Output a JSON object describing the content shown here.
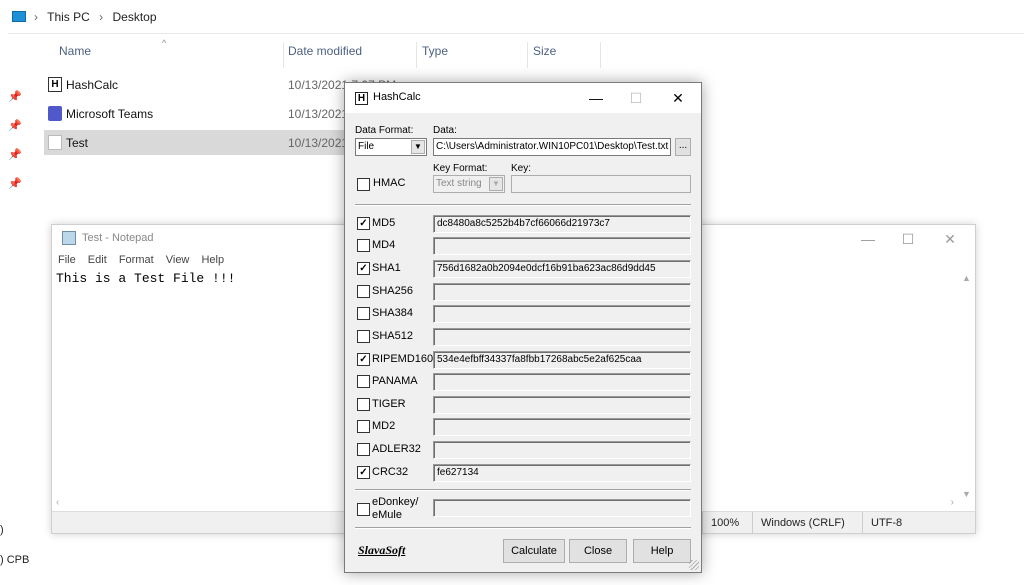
{
  "explorer": {
    "breadcrumb": [
      "This PC",
      "Desktop"
    ],
    "columns": {
      "name": "Name",
      "date": "Date modified",
      "type": "Type",
      "size": "Size"
    },
    "files": [
      {
        "name": "HashCalc",
        "date": "10/13/2021 7:07 PM"
      },
      {
        "name": "Microsoft Teams",
        "date": "10/13/2021"
      },
      {
        "name": "Test",
        "date": "10/13/2021"
      }
    ],
    "left_texts": [
      ")",
      ") CPB"
    ]
  },
  "notepad": {
    "title": "Test - Notepad",
    "menu": [
      "File",
      "Edit",
      "Format",
      "View",
      "Help"
    ],
    "content": "This is a Test File !!!",
    "status": {
      "zoom": "100%",
      "eol": "Windows (CRLF)",
      "encoding": "UTF-8"
    }
  },
  "hashcalc": {
    "title": "HashCalc",
    "data_format_label": "Data Format:",
    "data_format_value": "File",
    "data_label": "Data:",
    "data_value": "C:\\Users\\Administrator.WIN10PC01\\Desktop\\Test.txt",
    "browse_label": "...",
    "hmac_label": "HMAC",
    "key_format_label": "Key Format:",
    "key_format_value": "Text string",
    "key_label": "Key:",
    "key_value": "",
    "algorithms": [
      {
        "name": "MD5",
        "checked": true,
        "value": "dc8480a8c5252b4b7cf66066d21973c7"
      },
      {
        "name": "MD4",
        "checked": false,
        "value": ""
      },
      {
        "name": "SHA1",
        "checked": true,
        "value": "756d1682a0b2094e0dcf16b91ba623ac86d9dd45"
      },
      {
        "name": "SHA256",
        "checked": false,
        "value": ""
      },
      {
        "name": "SHA384",
        "checked": false,
        "value": ""
      },
      {
        "name": "SHA512",
        "checked": false,
        "value": ""
      },
      {
        "name": "RIPEMD160",
        "checked": true,
        "value": "534e4efbff34337fa8fbb17268abc5e2af625caa"
      },
      {
        "name": "PANAMA",
        "checked": false,
        "value": ""
      },
      {
        "name": "TIGER",
        "checked": false,
        "value": ""
      },
      {
        "name": "MD2",
        "checked": false,
        "value": ""
      },
      {
        "name": "ADLER32",
        "checked": false,
        "value": ""
      },
      {
        "name": "CRC32",
        "checked": true,
        "value": "fe627134"
      }
    ],
    "edonkey_line1": "eDonkey/",
    "edonkey_line2": "eMule",
    "edonkey_value": "",
    "logo": "SlavaSoft",
    "buttons": {
      "calculate": "Calculate",
      "close": "Close",
      "help": "Help"
    }
  }
}
